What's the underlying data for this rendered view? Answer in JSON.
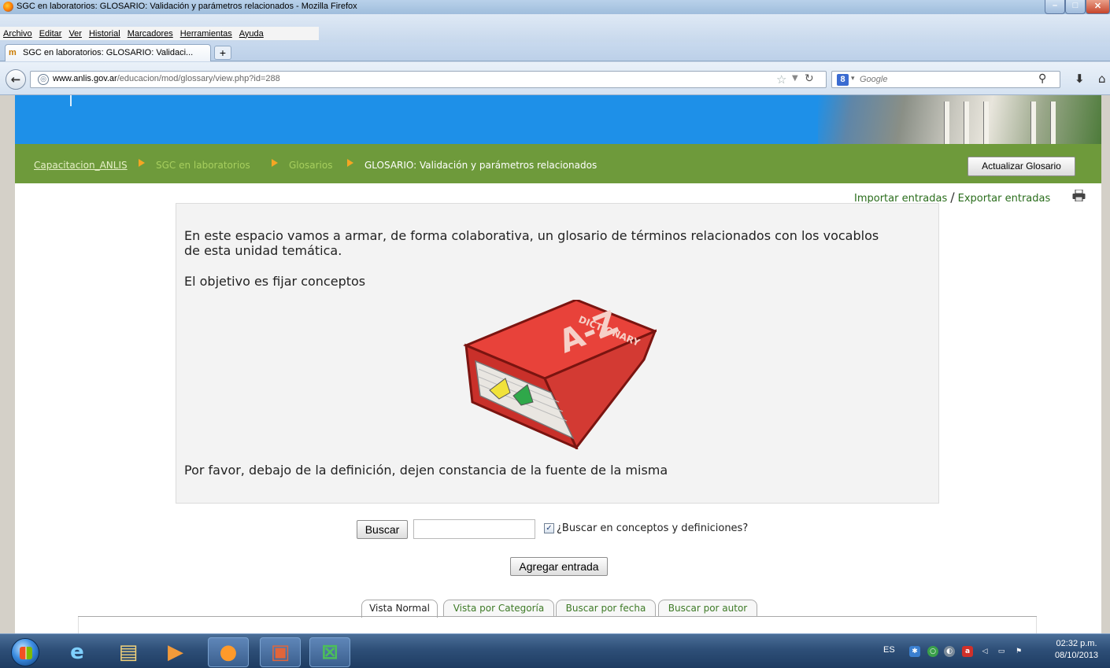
{
  "window": {
    "title": "SGC en laboratorios: GLOSARIO: Validación y parámetros relacionados - Mozilla Firefox"
  },
  "menu": [
    "Archivo",
    "Editar",
    "Ver",
    "Historial",
    "Marcadores",
    "Herramientas",
    "Ayuda"
  ],
  "tab": {
    "label": "SGC en laboratorios: GLOSARIO: Validaci...",
    "favicon": "moodle-icon",
    "new_tab_label": "+"
  },
  "navbar": {
    "url_domain": "www.anlis.gov.ar",
    "url_path": "/educacion/mod/glossary/view.php?id=288",
    "search_placeholder": "Google",
    "search_engine_label": "8"
  },
  "breadcrumb": {
    "items": [
      "Capacitacion_ANLIS",
      "SGC en laboratorios",
      "Glosarios",
      "GLOSARIO: Validación y parámetros relacionados"
    ]
  },
  "actions": {
    "update_glossary": "Actualizar Glosario",
    "import_entries": "Importar entradas",
    "separator": "/",
    "export_entries": "Exportar entradas"
  },
  "intro": {
    "p1": "En este espacio vamos a armar, de forma colaborativa, un glosario de términos relacionados con los vocablos de esta unidad temática.",
    "p2": "El objetivo es fijar conceptos",
    "p3": "Por favor, debajo de la definición, dejen constancia de la fuente de la misma"
  },
  "search": {
    "button": "Buscar",
    "value": "",
    "checkbox_checked": true,
    "checkbox_label": "¿Buscar en conceptos y definiciones?"
  },
  "add_entry": "Agregar entrada",
  "view_tabs": [
    "Vista Normal",
    "Vista por Categoría",
    "Buscar por fecha",
    "Buscar por autor"
  ],
  "taskbar": {
    "lang": "ES",
    "time": "02:32 p.m.",
    "date": "08/10/2013"
  },
  "colors": {
    "header_blue": "#1e90e8",
    "breadcrumb_green": "#6e9a3b",
    "link_green": "#2a6d1c"
  }
}
